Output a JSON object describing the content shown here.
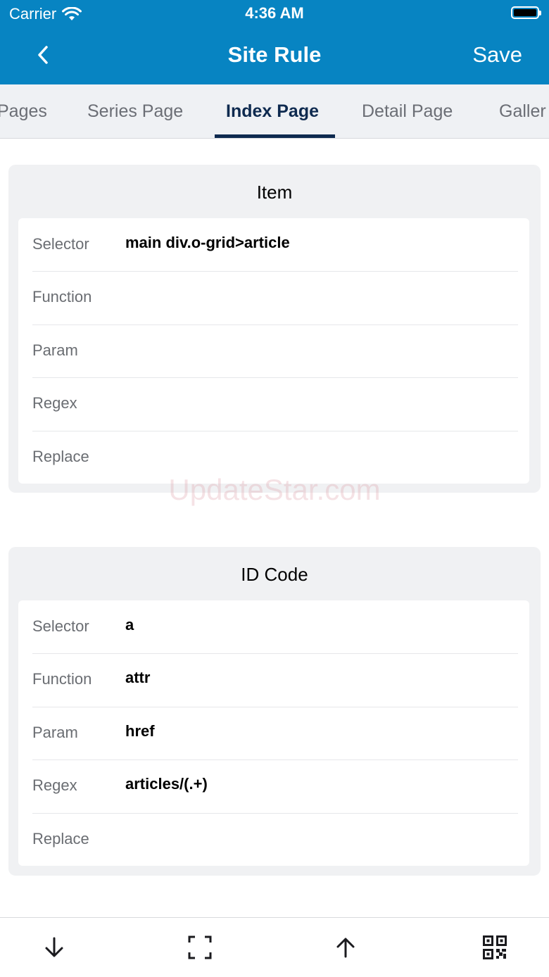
{
  "status_bar": {
    "carrier": "Carrier",
    "time": "4:36 AM"
  },
  "nav": {
    "title": "Site Rule",
    "save_label": "Save",
    "back_icon": "chevron-left-icon"
  },
  "tabs": [
    {
      "label": "Pages",
      "active": false
    },
    {
      "label": "Series Page",
      "active": false
    },
    {
      "label": "Index Page",
      "active": true
    },
    {
      "label": "Detail Page",
      "active": false
    },
    {
      "label": "Galler",
      "active": false
    }
  ],
  "cards": [
    {
      "title": "Item",
      "rows": [
        {
          "label": "Selector",
          "value": "main div.o-grid>article"
        },
        {
          "label": "Function",
          "value": ""
        },
        {
          "label": "Param",
          "value": ""
        },
        {
          "label": "Regex",
          "value": ""
        },
        {
          "label": "Replace",
          "value": ""
        }
      ]
    },
    {
      "title": "ID Code",
      "rows": [
        {
          "label": "Selector",
          "value": "a"
        },
        {
          "label": "Function",
          "value": "attr"
        },
        {
          "label": "Param",
          "value": "href"
        },
        {
          "label": "Regex",
          "value": "articles/(.+)"
        },
        {
          "label": "Replace",
          "value": ""
        }
      ]
    }
  ],
  "watermark": "UpdateStar.com",
  "toolbar": {
    "icons": [
      "arrow-down-icon",
      "scan-frame-icon",
      "arrow-up-icon",
      "qr-code-icon"
    ]
  },
  "colors": {
    "nav_background": "#0784c2",
    "active_tab": "#0e2a4f"
  }
}
